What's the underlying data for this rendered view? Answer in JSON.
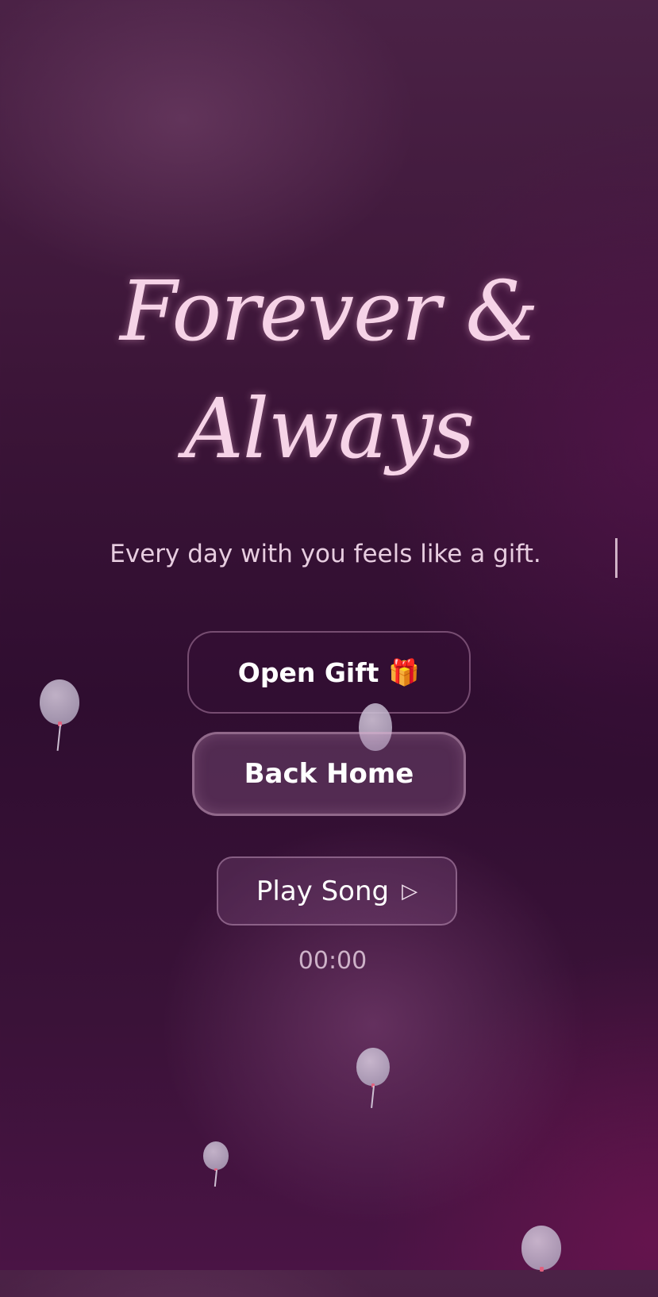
{
  "hero": {
    "title_line1": "Forever &",
    "title_line2": "Always",
    "subtitle": "Every day with you feels like a gift."
  },
  "buttons": {
    "open_gift_label": "Open Gift",
    "open_gift_icon": "🎁",
    "back_home_label": "Back Home",
    "play_song_label": "Play Song",
    "play_icon": "▷"
  },
  "player": {
    "time": "00:00"
  },
  "colors": {
    "title": "#f6d3e7",
    "background_dark": "#2f0d30",
    "accent": "#e0607f"
  }
}
